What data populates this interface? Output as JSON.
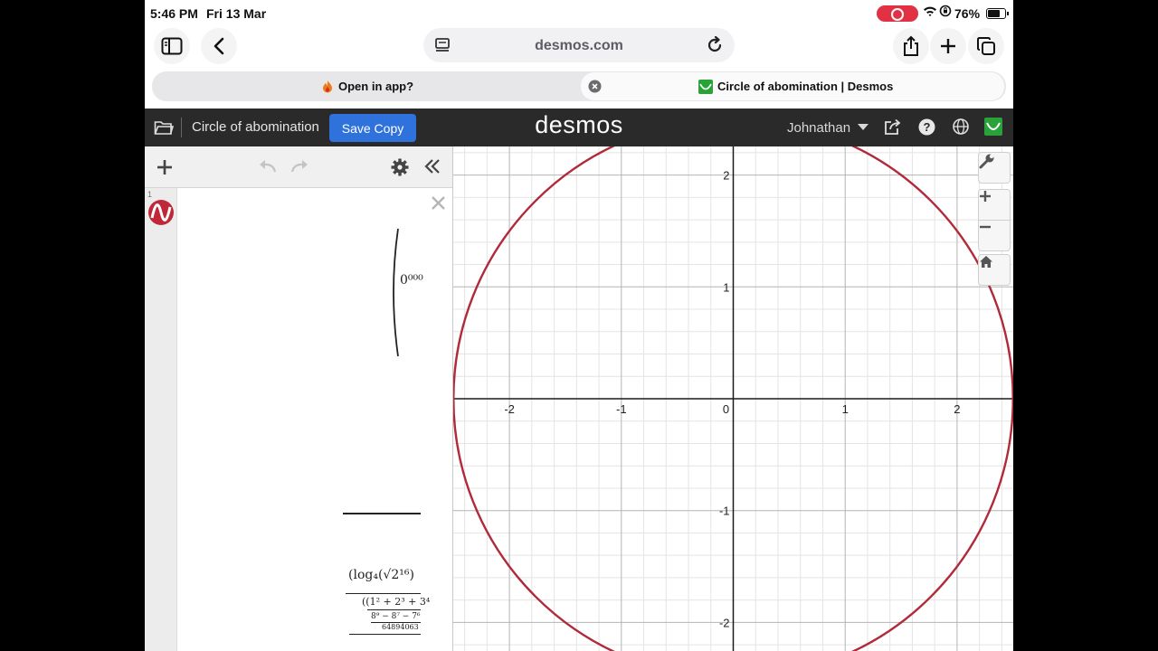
{
  "status_bar": {
    "time": "5:46 PM",
    "date": "Fri 13 Mar",
    "battery_pct": "76%",
    "battery_level": 0.76,
    "recording_color": "#e23045"
  },
  "safari": {
    "url": "desmos.com",
    "icons": [
      "sidebar-icon",
      "back-icon",
      "reader-icon",
      "reload-icon",
      "share-icon",
      "new-tab-icon",
      "tabs-overview-icon"
    ]
  },
  "tabs": {
    "inactive_label": "Open in app?",
    "active_label": "Circle of abomination | Desmos"
  },
  "desmos_header": {
    "graph_title": "Circle of abomination",
    "save_label": "Save Copy",
    "logo": "desmos",
    "user_name": "Johnathan",
    "accent": "#2f72dc",
    "header_bg": "#2a2a2a"
  },
  "expression_list": {
    "item_index": "1",
    "icon_color": "#c0283a",
    "math_top": "0⁰⁰⁰",
    "math_log": "(log₄(√2¹⁶)",
    "math_row2": "((1² + 2³ + 3⁴",
    "math_row3": "8⁹ − 8⁷ − 7⁶",
    "math_row4": "64894063"
  },
  "graph": {
    "curve_color": "#b02a3a",
    "x_ticks": [
      "-2",
      "-1",
      "0",
      "1",
      "2"
    ],
    "y_ticks": [
      "2",
      "1",
      "-1",
      "-2"
    ]
  },
  "chart_data": {
    "type": "line",
    "title": "",
    "series": [
      {
        "name": "",
        "shape": "circle",
        "center": [
          0,
          0
        ],
        "radius": 2.5
      }
    ],
    "xlim": [
      -2.5,
      2.5
    ],
    "ylim": [
      -2.25,
      2.25
    ],
    "major_grid_step": 1,
    "minor_grid_step": 0.2,
    "grid": true
  }
}
